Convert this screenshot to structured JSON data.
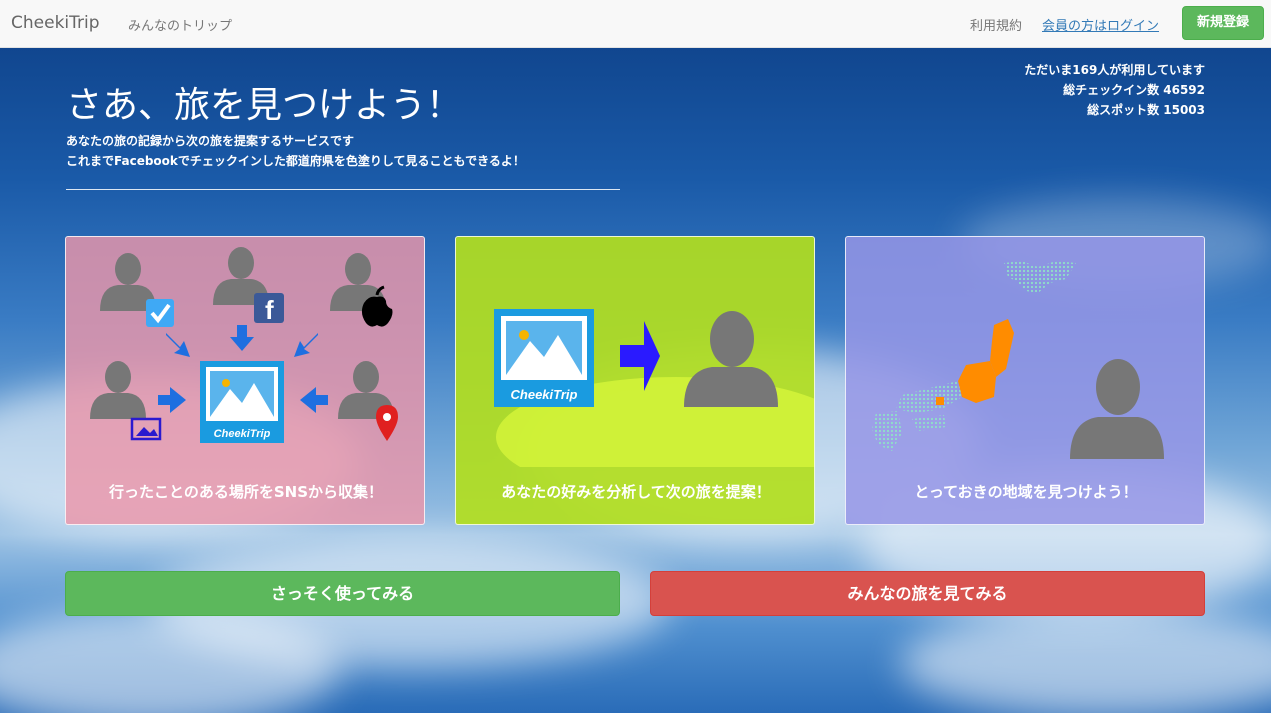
{
  "navbar": {
    "brand": "CheekiTrip",
    "trips_link": "みんなのトリップ",
    "terms_link": "利用規約",
    "login_link": "会員の方はログイン",
    "signup_button": "新規登録"
  },
  "hero": {
    "title": "さあ、旅を見つけよう！",
    "subtitle_line1": "あなたの旅の記録から次の旅を提案するサービスです",
    "subtitle_line2": "これまでFacebookでチェックインした都道府県を色塗りして見ることもできるよ！"
  },
  "stats": {
    "users_now": "ただいま169人が利用しています",
    "checkins": "総チェックイン数 46592",
    "spots": "総スポット数 15003"
  },
  "cards": [
    {
      "caption": "行ったことのある場所をSNSから収集！"
    },
    {
      "caption": "あなたの好みを分析して次の旅を提案！",
      "logo_text": "CheekiTrip"
    },
    {
      "caption": "とっておきの地域を見つけよう！"
    }
  ],
  "card1_logo_text": "CheekiTrip",
  "actions": {
    "start_button": "さっそく使ってみる",
    "see_button": "みんなの旅を見てみる"
  },
  "colors": {
    "success": "#5cb85c",
    "danger": "#d9534f",
    "link": "#337ab7",
    "card1": "#ec96aa",
    "card2": "#b2de1e",
    "card3": "#9696e6",
    "japan_highlight": "#ff8c00"
  }
}
